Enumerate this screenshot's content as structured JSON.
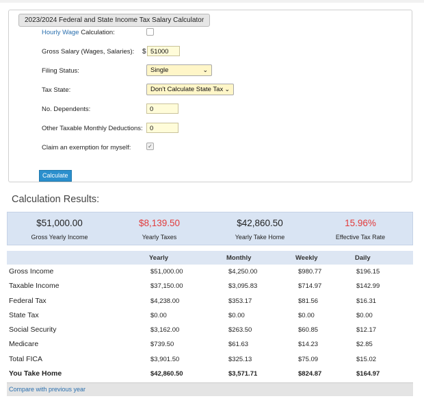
{
  "calculator": {
    "legend": "2023/2024 Federal and State Income Tax Salary Calculator",
    "hourly_link": "Hourly Wage",
    "hourly_suffix": "Calculation:",
    "gross_label": "Gross Salary (Wages, Salaries):",
    "currency_symbol": "$",
    "gross_value": "51000",
    "filing_label": "Filing Status:",
    "filing_value": "Single",
    "state_label": "Tax State:",
    "state_value": "Don't Calculate State Tax",
    "dependents_label": "No. Dependents:",
    "dependents_value": "0",
    "deductions_label": "Other Taxable Monthly Deductions:",
    "deductions_value": "0",
    "exemption_label": "Claim an exemption for myself:",
    "exemption_checked": true,
    "hourly_checked": false,
    "calculate_label": "Calculate"
  },
  "results": {
    "title": "Calculation Results:",
    "summary": [
      {
        "value": "$51,000.00",
        "label": "Gross Yearly Income",
        "color": "#222222"
      },
      {
        "value": "$8,139.50",
        "label": "Yearly Taxes",
        "color": "#e23b3b"
      },
      {
        "value": "$42,860.50",
        "label": "Yearly Take Home",
        "color": "#222222"
      },
      {
        "value": "15.96%",
        "label": "Effective Tax Rate",
        "color": "#e23b3b"
      }
    ],
    "columns": [
      "",
      "Yearly",
      "Monthly",
      "Weekly",
      "Daily"
    ],
    "rows": [
      {
        "name": "Gross Income",
        "yearly": "$51,000.00",
        "monthly": "$4,250.00",
        "weekly": "$980.77",
        "daily": "$196.15"
      },
      {
        "name": "Taxable Income",
        "yearly": "$37,150.00",
        "monthly": "$3,095.83",
        "weekly": "$714.97",
        "daily": "$142.99"
      },
      {
        "name": "Federal Tax",
        "yearly": "$4,238.00",
        "monthly": "$353.17",
        "weekly": "$81.56",
        "daily": "$16.31"
      },
      {
        "name": "State Tax",
        "yearly": "$0.00",
        "monthly": "$0.00",
        "weekly": "$0.00",
        "daily": "$0.00"
      },
      {
        "name": "Social Security",
        "yearly": "$3,162.00",
        "monthly": "$263.50",
        "weekly": "$60.85",
        "daily": "$12.17"
      },
      {
        "name": "Medicare",
        "yearly": "$739.50",
        "monthly": "$61.63",
        "weekly": "$14.23",
        "daily": "$2.85"
      },
      {
        "name": "Total FICA",
        "yearly": "$3,901.50",
        "monthly": "$325.13",
        "weekly": "$75.09",
        "daily": "$15.02"
      },
      {
        "name": "You Take Home",
        "yearly": "$42,860.50",
        "monthly": "$3,571.71",
        "weekly": "$824.87",
        "daily": "$164.97"
      }
    ],
    "compare_link": "Compare with previous year"
  }
}
